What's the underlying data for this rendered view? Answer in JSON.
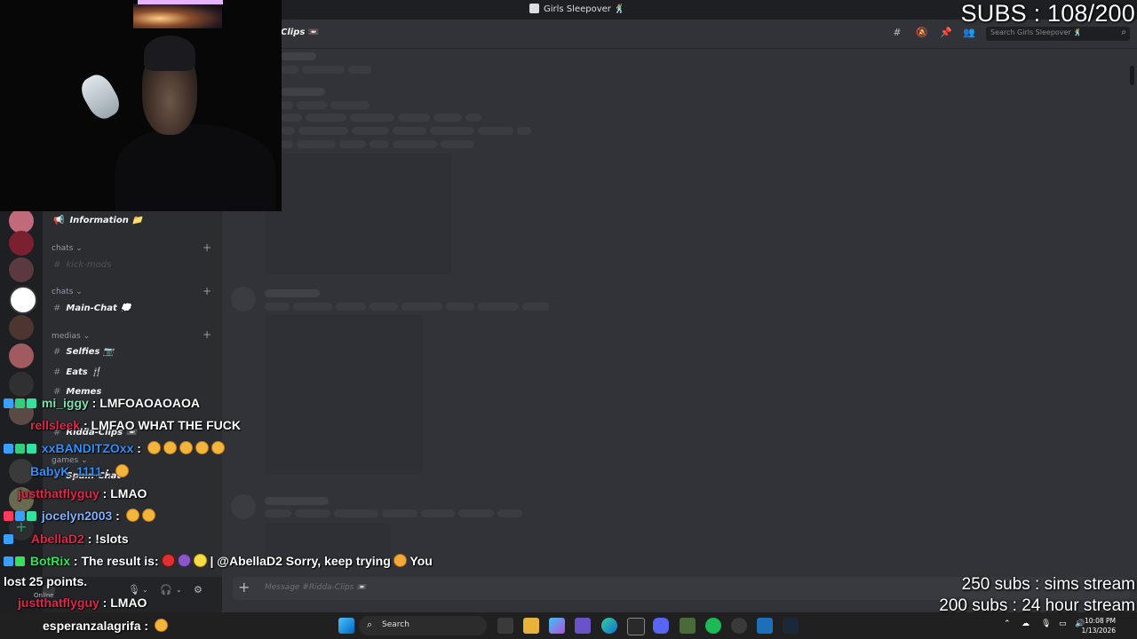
{
  "window": {
    "title": "Girls Sleepover 🕺"
  },
  "header": {
    "channel_name": "Clips",
    "search_placeholder": "Search Girls Sleepover 🕺"
  },
  "sidebar": {
    "information": "Information 📁",
    "categories": {
      "chats_1": "chats ⌄",
      "chats_2": "chats ⌄",
      "medias": "medias ⌄",
      "games": "games ⌄"
    },
    "channels": {
      "kick_mods": "kick-mods",
      "main_chat": "Main-Chat 💭",
      "selfies": "Selfies 📷",
      "eats": "Eats 🍴",
      "memes": "Memes",
      "ridda_clips": "Ridda-Clips 📼",
      "spain_chat": "Spain-Chat"
    }
  },
  "composer": {
    "placeholder": "Message #Ridda-Clips 📼"
  },
  "user_panel": {
    "status": "Online"
  },
  "taskbar": {
    "search_label": "Search",
    "time": "10:08 PM",
    "date": "1/13/2026"
  },
  "overlay": {
    "subs": "SUBS : 108/200",
    "goal_1": "250 subs : sims stream",
    "goal_2": "200 subs : 24 hour stream"
  },
  "chat": [
    {
      "user": "mi_iggy",
      "sep": " : ",
      "message": "LMFOAOAOAOA",
      "color": "#7fe0b0"
    },
    {
      "user": "rellsleek",
      "sep": " : ",
      "message": "LMFAO WHAT THE FUCK",
      "color": "#e0264b"
    },
    {
      "user": "xxBANDITZOxx",
      "sep": " : ",
      "message": "",
      "color": "#2e90ff"
    },
    {
      "user": "BabyK_1111",
      "sep": " : ",
      "message": "",
      "color": "#2e90ff"
    },
    {
      "user": "justthatflyguy",
      "sep": " : ",
      "message": "LMAO",
      "color": "#e0264b"
    },
    {
      "user": "jocelyn2003",
      "sep": " : ",
      "message": "",
      "color": "#7fb0ff"
    },
    {
      "user": "AbellaD2",
      "sep": " : ",
      "message": "!slots",
      "color": "#e0264b"
    },
    {
      "user": "BotRix",
      "sep": " : ",
      "message": "The result is:",
      "color": "#36e05a"
    },
    {
      "message": "| @AbellaD2 Sorry, keep trying"
    },
    {
      "message": "You"
    },
    {
      "message": "lost 25 points."
    },
    {
      "user": "justthatflyguy",
      "sep": " : ",
      "message": "LMAO",
      "color": "#e0264b"
    },
    {
      "user": "esperanzalagrifa",
      "sep": " : ",
      "message": "",
      "color": "#ffffff"
    }
  ],
  "colors": {
    "discord_bg": "#313338",
    "sidebar_bg": "#2b2d31",
    "guild_bar_bg": "#1e1f22",
    "taskbar_bg": "#202020"
  }
}
